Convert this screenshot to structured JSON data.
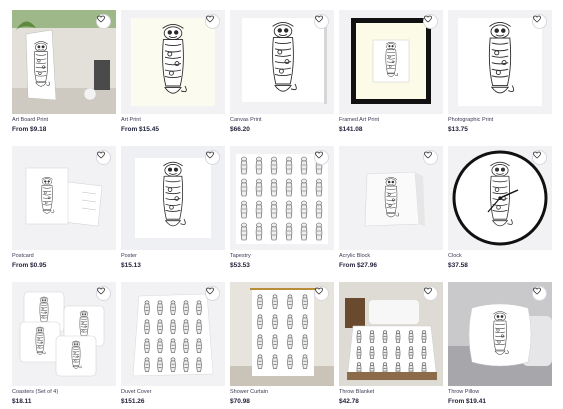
{
  "products": [
    {
      "name": "Art Board Print",
      "price": "From $9.18",
      "icon": "art-board-print"
    },
    {
      "name": "Art Print",
      "price": "From $15.45",
      "icon": "art-print"
    },
    {
      "name": "Canvas Print",
      "price": "$66.20",
      "icon": "canvas-print"
    },
    {
      "name": "Framed Art Print",
      "price": "$141.08",
      "icon": "framed-art-print"
    },
    {
      "name": "Photographic Print",
      "price": "$13.75",
      "icon": "photographic-print"
    },
    {
      "name": "Postcard",
      "price": "From $0.95",
      "icon": "postcard"
    },
    {
      "name": "Poster",
      "price": "$15.13",
      "icon": "poster"
    },
    {
      "name": "Tapestry",
      "price": "$53.53",
      "icon": "tapestry"
    },
    {
      "name": "Acrylic Block",
      "price": "From $27.96",
      "icon": "acrylic-block"
    },
    {
      "name": "Clock",
      "price": "$37.58",
      "icon": "clock"
    },
    {
      "name": "Coasters (Set of 4)",
      "price": "$18.11",
      "icon": "coasters"
    },
    {
      "name": "Duvet Cover",
      "price": "$151.26",
      "icon": "duvet-cover"
    },
    {
      "name": "Shower Curtain",
      "price": "$70.98",
      "icon": "shower-curtain"
    },
    {
      "name": "Throw Blanket",
      "price": "$42.78",
      "icon": "throw-blanket"
    },
    {
      "name": "Throw Pillow",
      "price": "From $19.41",
      "icon": "throw-pillow"
    }
  ],
  "favorite_icon": "heart-icon"
}
